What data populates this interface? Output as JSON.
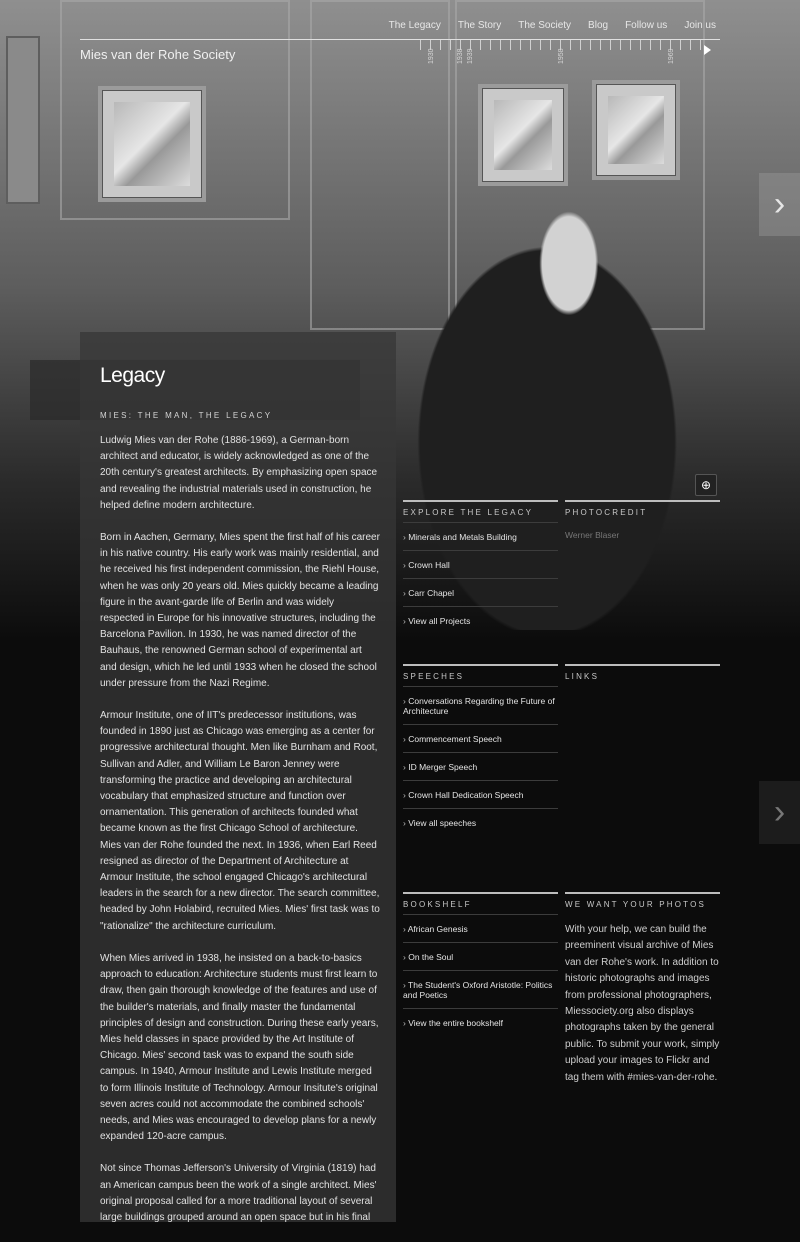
{
  "site": {
    "title": "Mies van der Rohe Society"
  },
  "topnav": [
    "The Legacy",
    "The Story",
    "The Society",
    "Blog",
    "Follow us",
    "Join us"
  ],
  "timeline": {
    "years": [
      "1930",
      "1938",
      "1939",
      "1958",
      "1969"
    ]
  },
  "legacy": {
    "title": "Legacy",
    "kicker": "MIES: THE MAN, THE LEGACY",
    "paragraphs": [
      "Ludwig Mies van der Rohe (1886-1969), a German-born architect and educator, is widely acknowledged as one of the 20th century's greatest architects. By emphasizing open space and revealing the industrial materials used in construction, he helped define modern architecture.",
      "Born in Aachen, Germany, Mies spent the first half of his career in his native country. His early work was mainly residential, and he received his first independent commission, the Riehl House, when he was only 20 years old. Mies quickly became a leading figure in the avant-garde life of Berlin and was widely respected in Europe for his innovative structures, including the Barcelona Pavilion. In 1930, he was named director of the Bauhaus, the renowned German school of experimental art and design, which he led until 1933 when he closed the school under pressure from the Nazi Regime.",
      "Armour Institute, one of IIT's predecessor institutions, was founded in 1890 just as Chicago was emerging as a center for progressive architectural thought. Men like Burnham and Root, Sullivan and Adler, and William Le Baron Jenney were transforming the practice and developing an architectural vocabulary that emphasized structure and function over ornamentation. This generation of architects founded what became known as the first Chicago School of architecture. Mies van der Rohe founded the next. In 1936, when Earl Reed resigned as director of the Department of Architecture at Armour Institute, the school engaged Chicago's architectural leaders in the search for a new director. The search committee, headed by John Holabird, recruited Mies. Mies' first task was to \"rationalize\" the architecture curriculum.",
      "When Mies arrived in 1938, he insisted on a back-to-basics approach to education: Architecture students must first learn to draw, then gain thorough knowledge of the features and use of the builder's materials, and finally master the fundamental principles of design and construction. During these early years, Mies held classes in space provided by the Art Institute of Chicago. Mies' second task was to expand the south side campus. In 1940, Armour Institute and Lewis Institute merged to form Illinois Institute of Technology. Armour Insitute's original seven acres could not accommodate the combined schools' needs, and Mies was encouraged to develop plans for a newly expanded 120-acre campus.",
      "Not since Thomas Jefferson's University of Virginia (1819) had an American campus been the work of a single architect. Mies' original proposal called for a more traditional layout of several large buildings grouped around an open space but in his final"
    ]
  },
  "explore": {
    "heading": "EXPLORE THE LEGACY",
    "items": [
      "Minerals and Metals Building",
      "Crown Hall",
      "Carr Chapel",
      "View all Projects"
    ]
  },
  "photocredit": {
    "heading": "PHOTOCREDIT",
    "name": "Werner Blaser"
  },
  "speeches": {
    "heading": "SPEECHES",
    "items": [
      "Conversations Regarding the Future of Architecture",
      "Commencement Speech",
      "ID Merger Speech",
      "Crown Hall Dedication Speech",
      "View all speeches"
    ]
  },
  "links": {
    "heading": "LINKS"
  },
  "bookshelf": {
    "heading": "BOOKSHELF",
    "items": [
      "African Genesis",
      "On the Soul",
      "The Student's Oxford Aristotle: Politics and Poetics",
      "View the entire bookshelf"
    ]
  },
  "photos": {
    "heading": "WE WANT YOUR PHOTOS",
    "text": "With your help, we can build the preeminent visual archive of Mies van der Rohe's work. In addition to historic photographs and images from professional photographers, Miessociety.org also displays photographs taken by the general public. To submit your work, simply upload your images to Flickr and tag them with #mies-van-der-rohe."
  },
  "icons": {
    "next": "chevron-right-icon",
    "zoom": "zoom-icon"
  }
}
